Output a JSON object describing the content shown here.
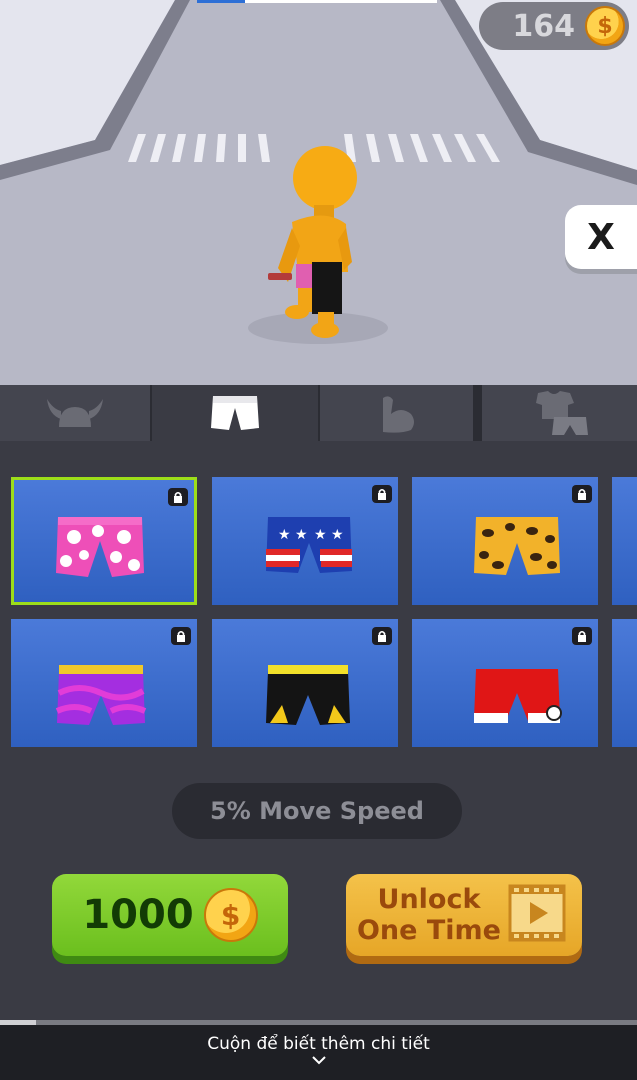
{
  "hud": {
    "coins": "164",
    "coin_symbol": "$",
    "close_label": "X"
  },
  "tabs": [
    {
      "id": "helmet",
      "icon": "viking-helmet-icon",
      "active": false
    },
    {
      "id": "shorts",
      "icon": "shorts-icon",
      "active": true
    },
    {
      "id": "arm",
      "icon": "arm-muscle-icon",
      "active": false
    },
    {
      "id": "outfit",
      "icon": "outfit-icon",
      "active": false
    }
  ],
  "items": [
    {
      "name": "pink-polka-dot-shorts",
      "selected": true,
      "locked": true
    },
    {
      "name": "usa-flag-shorts",
      "selected": false,
      "locked": true
    },
    {
      "name": "leopard-print-shorts",
      "selected": false,
      "locked": true
    },
    {
      "name": "purple-wave-shorts",
      "selected": false,
      "locked": true
    },
    {
      "name": "black-yellow-shorts",
      "selected": false,
      "locked": true
    },
    {
      "name": "red-pokeball-shorts",
      "selected": false,
      "locked": true
    }
  ],
  "stat": {
    "text": "5% Move Speed"
  },
  "buy": {
    "price": "1000",
    "coin_symbol": "$"
  },
  "unlock": {
    "line1": "Unlock",
    "line2": "One Time"
  },
  "footer": {
    "text": "Cuộn để biết thêm chi tiết"
  },
  "colors": {
    "selected_border": "#9dde1a",
    "card_blue": "#3a6ccc",
    "buy_green": "#7cc72a",
    "unlock_orange": "#f0b43a"
  }
}
